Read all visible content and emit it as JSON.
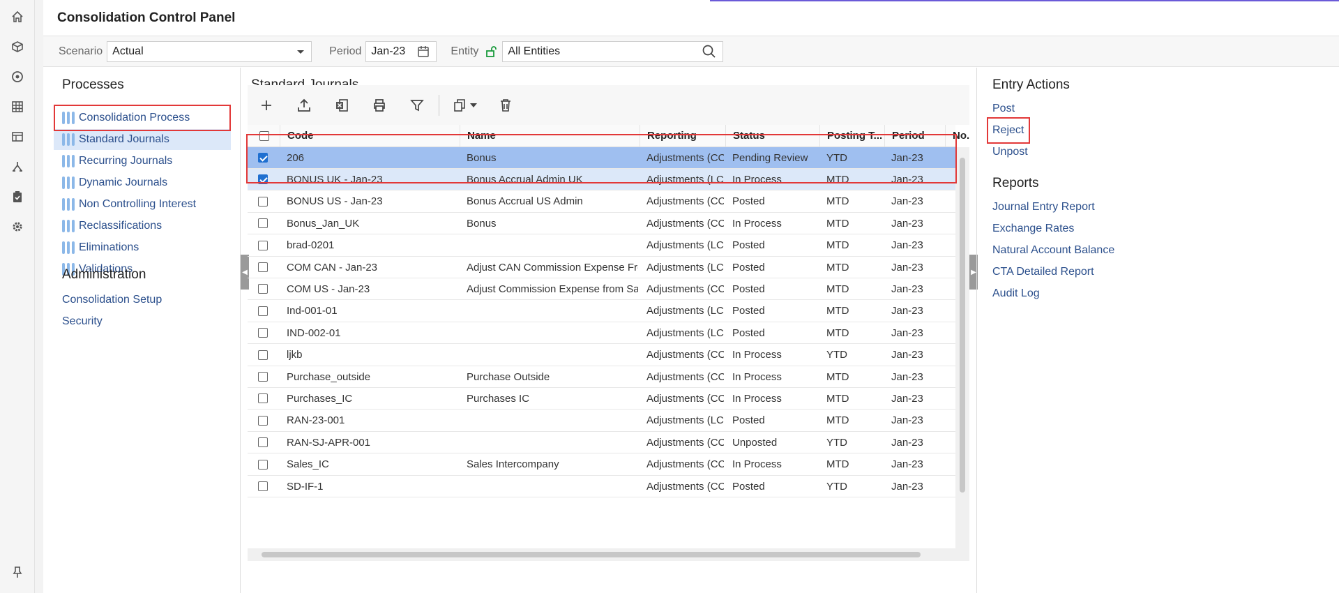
{
  "header": {
    "title": "Consolidation Control Panel"
  },
  "filters": {
    "scenario_label": "Scenario",
    "scenario_value": "Actual",
    "period_label": "Period",
    "period_value": "Jan-23",
    "entity_label": "Entity",
    "entity_value": "All Entities"
  },
  "processes": {
    "heading": "Processes",
    "items": [
      "Consolidation Process",
      "Standard Journals",
      "Recurring Journals",
      "Dynamic Journals",
      "Non Controlling Interest",
      "Reclassifications",
      "Eliminations",
      "Validations"
    ],
    "selected": "Standard Journals"
  },
  "administration": {
    "heading": "Administration",
    "items": [
      "Consolidation Setup",
      "Security"
    ]
  },
  "journals": {
    "title": "Standard Journals",
    "toolbar": [
      "add-icon",
      "upload-icon",
      "excel-icon",
      "print-icon",
      "filter-icon",
      "copy-icon",
      "delete-icon"
    ],
    "columns": [
      "Code",
      "Name",
      "Reporting",
      "Status",
      "Posting T...",
      "Period",
      "No..."
    ],
    "rows": [
      {
        "code": "206",
        "name": "Bonus",
        "reporting": "Adjustments (CC)",
        "status": "Pending Review",
        "posting": "YTD",
        "period": "Jan-23",
        "checked": true
      },
      {
        "code": "BONUS UK - Jan-23",
        "name": "Bonus Accrual Admin UK",
        "reporting": "Adjustments (LC)",
        "status": "In Process",
        "posting": "MTD",
        "period": "Jan-23",
        "checked": true
      },
      {
        "code": "BONUS US - Jan-23",
        "name": "Bonus Accrual US Admin",
        "reporting": "Adjustments (CC)",
        "status": "Posted",
        "posting": "MTD",
        "period": "Jan-23",
        "checked": false
      },
      {
        "code": "Bonus_Jan_UK",
        "name": "Bonus",
        "reporting": "Adjustments (CC)",
        "status": "In Process",
        "posting": "MTD",
        "period": "Jan-23",
        "checked": false
      },
      {
        "code": "brad-0201",
        "name": "",
        "reporting": "Adjustments (LC)",
        "status": "Posted",
        "posting": "MTD",
        "period": "Jan-23",
        "checked": false
      },
      {
        "code": "COM CAN - Jan-23",
        "name": "Adjust CAN Commission Expense Fro...",
        "reporting": "Adjustments (LC)",
        "status": "Posted",
        "posting": "MTD",
        "period": "Jan-23",
        "checked": false
      },
      {
        "code": "COM US - Jan-23",
        "name": "Adjust Commission Expense from Sale...",
        "reporting": "Adjustments (CC)",
        "status": "Posted",
        "posting": "MTD",
        "period": "Jan-23",
        "checked": false
      },
      {
        "code": "Ind-001-01",
        "name": "",
        "reporting": "Adjustments (LC)",
        "status": "Posted",
        "posting": "MTD",
        "period": "Jan-23",
        "checked": false
      },
      {
        "code": "IND-002-01",
        "name": "",
        "reporting": "Adjustments (LC)",
        "status": "Posted",
        "posting": "MTD",
        "period": "Jan-23",
        "checked": false
      },
      {
        "code": "ljkb",
        "name": "",
        "reporting": "Adjustments (CC)",
        "status": "In Process",
        "posting": "YTD",
        "period": "Jan-23",
        "checked": false
      },
      {
        "code": "Purchase_outside",
        "name": "Purchase Outside",
        "reporting": "Adjustments (CC)",
        "status": "In Process",
        "posting": "MTD",
        "period": "Jan-23",
        "checked": false
      },
      {
        "code": "Purchases_IC",
        "name": "Purchases IC",
        "reporting": "Adjustments (CC)",
        "status": "In Process",
        "posting": "MTD",
        "period": "Jan-23",
        "checked": false
      },
      {
        "code": "RAN-23-001",
        "name": "",
        "reporting": "Adjustments (LC)",
        "status": "Posted",
        "posting": "MTD",
        "period": "Jan-23",
        "checked": false
      },
      {
        "code": "RAN-SJ-APR-001",
        "name": "",
        "reporting": "Adjustments (CC)",
        "status": "Unposted",
        "posting": "YTD",
        "period": "Jan-23",
        "checked": false
      },
      {
        "code": "Sales_IC",
        "name": "Sales Intercompany",
        "reporting": "Adjustments (CC)",
        "status": "In Process",
        "posting": "MTD",
        "period": "Jan-23",
        "checked": false
      },
      {
        "code": "SD-IF-1",
        "name": "",
        "reporting": "Adjustments (CC)",
        "status": "Posted",
        "posting": "YTD",
        "period": "Jan-23",
        "checked": false
      }
    ]
  },
  "entry_actions": {
    "heading": "Entry Actions",
    "items": [
      "Post",
      "Reject",
      "Unpost"
    ]
  },
  "reports": {
    "heading": "Reports",
    "items": [
      "Journal Entry Report",
      "Exchange Rates",
      "Natural Account Balance",
      "CTA Detailed Report",
      "Audit Log"
    ]
  },
  "colors": {
    "link": "#2b4f8c",
    "selected_row": "#9fbff0",
    "selected_row_light": "#dce8f9",
    "highlight_box": "#e23838",
    "accent": "#6a5ad8"
  }
}
